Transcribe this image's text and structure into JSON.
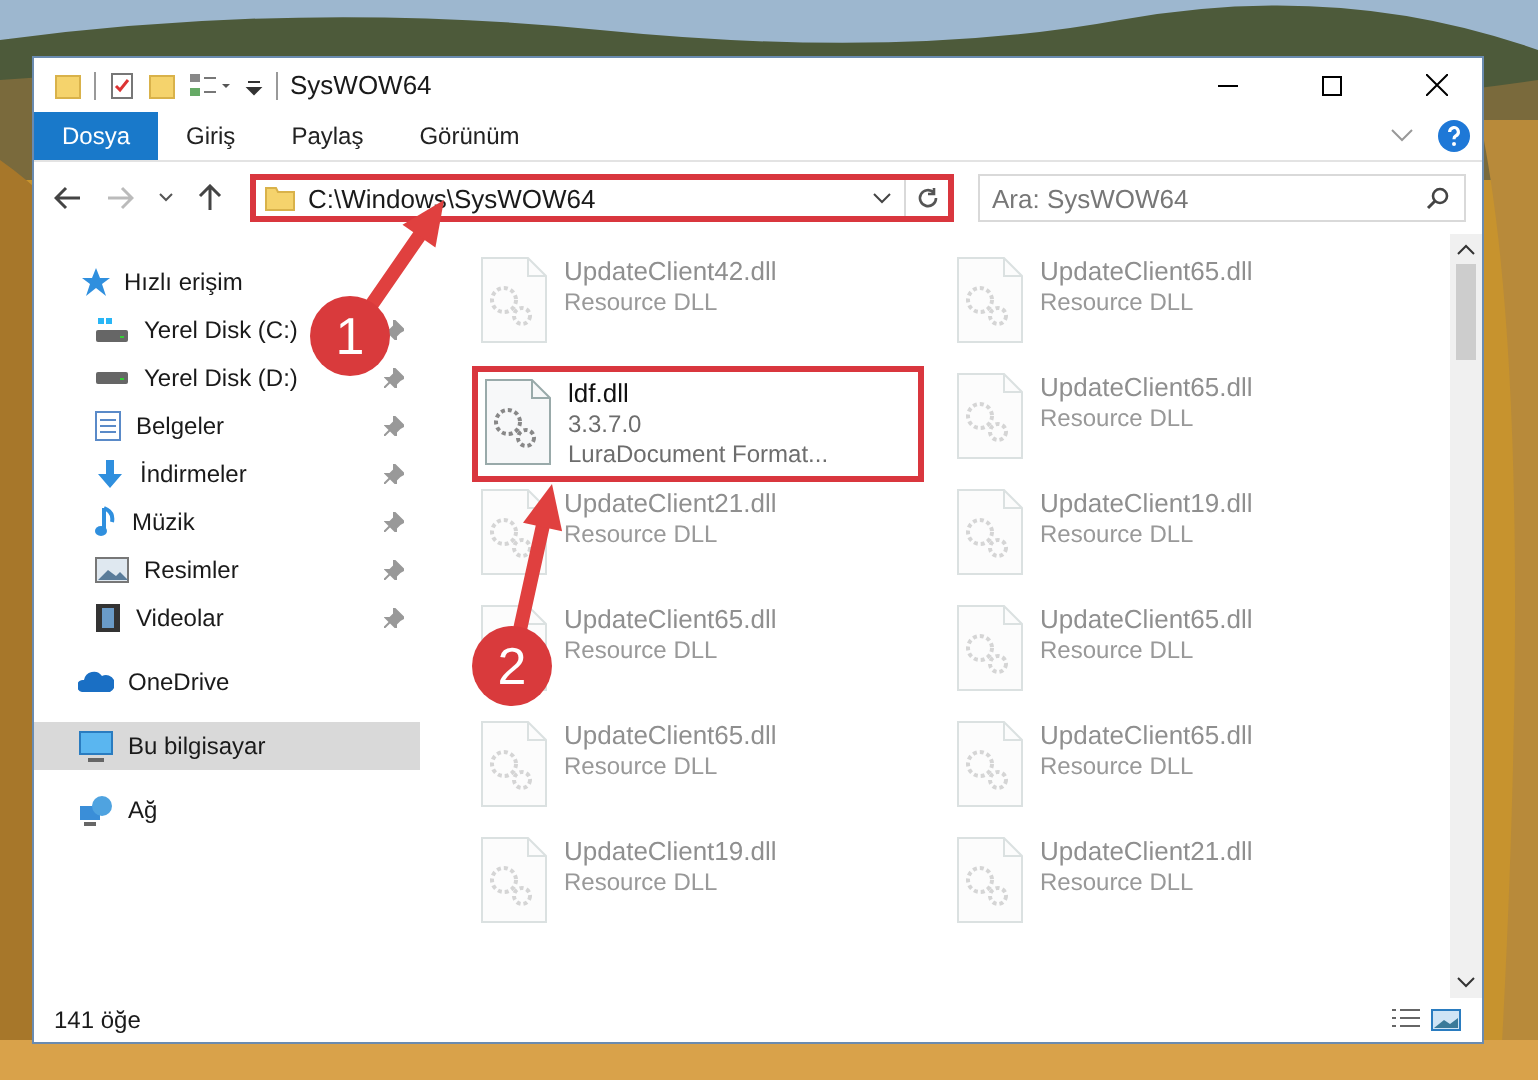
{
  "window": {
    "title": "SysWOW64"
  },
  "ribbon_tabs": [
    {
      "label": "Dosya",
      "selected": true
    },
    {
      "label": "Giriş",
      "selected": false
    },
    {
      "label": "Paylaş",
      "selected": false
    },
    {
      "label": "Görünüm",
      "selected": false
    }
  ],
  "address_bar": {
    "path": "C:\\Windows\\SysWOW64",
    "highlighted": true
  },
  "search": {
    "placeholder": "Ara: SysWOW64"
  },
  "sidebar": {
    "items": [
      {
        "label": "Hızlı erişim",
        "selected": false,
        "children": [
          {
            "label": "Yerel Disk (C:)",
            "selected": false,
            "pinned": true
          },
          {
            "label": "Yerel Disk (D:)",
            "selected": false,
            "pinned": true
          },
          {
            "label": "Belgeler",
            "selected": false,
            "pinned": true
          },
          {
            "label": "İndirmeler",
            "selected": false,
            "pinned": true
          },
          {
            "label": "Müzik",
            "selected": false,
            "pinned": true
          },
          {
            "label": "Resimler",
            "selected": false,
            "pinned": true
          },
          {
            "label": "Videolar",
            "selected": false,
            "pinned": true
          }
        ]
      },
      {
        "label": "OneDrive",
        "selected": false
      },
      {
        "label": "Bu bilgisayar",
        "selected": true
      },
      {
        "label": "Ağ",
        "selected": false
      }
    ]
  },
  "files": [
    {
      "name": "UpdateClient42.dll",
      "details": [
        "Resource DLL"
      ],
      "faded": true,
      "highlighted": false
    },
    {
      "name": "UpdateClient65.dll",
      "details": [
        "Resource DLL"
      ],
      "faded": true,
      "highlighted": false
    },
    {
      "name": "ldf.dll",
      "details": [
        "3.3.7.0",
        "LuraDocument Format..."
      ],
      "faded": false,
      "highlighted": true
    },
    {
      "name": "UpdateClient65.dll",
      "details": [
        "Resource DLL"
      ],
      "faded": true,
      "highlighted": false
    },
    {
      "name": "UpdateClient21.dll",
      "details": [
        "Resource DLL"
      ],
      "faded": true,
      "highlighted": false
    },
    {
      "name": "UpdateClient19.dll",
      "details": [
        "Resource DLL"
      ],
      "faded": true,
      "highlighted": false
    },
    {
      "name": "UpdateClient65.dll",
      "details": [
        "Resource DLL"
      ],
      "faded": true,
      "highlighted": false
    },
    {
      "name": "UpdateClient65.dll",
      "details": [
        "Resource DLL"
      ],
      "faded": true,
      "highlighted": false
    },
    {
      "name": "UpdateClient65.dll",
      "details": [
        "Resource DLL"
      ],
      "faded": true,
      "highlighted": false
    },
    {
      "name": "UpdateClient65.dll",
      "details": [
        "Resource DLL"
      ],
      "faded": true,
      "highlighted": false
    },
    {
      "name": "UpdateClient19.dll",
      "details": [
        "Resource DLL"
      ],
      "faded": true,
      "highlighted": false
    },
    {
      "name": "UpdateClient21.dll",
      "details": [
        "Resource DLL"
      ],
      "faded": true,
      "highlighted": false
    }
  ],
  "status_bar": {
    "item_count": "141 öğe"
  },
  "annotations": [
    {
      "label": "1"
    },
    {
      "label": "2"
    }
  ]
}
